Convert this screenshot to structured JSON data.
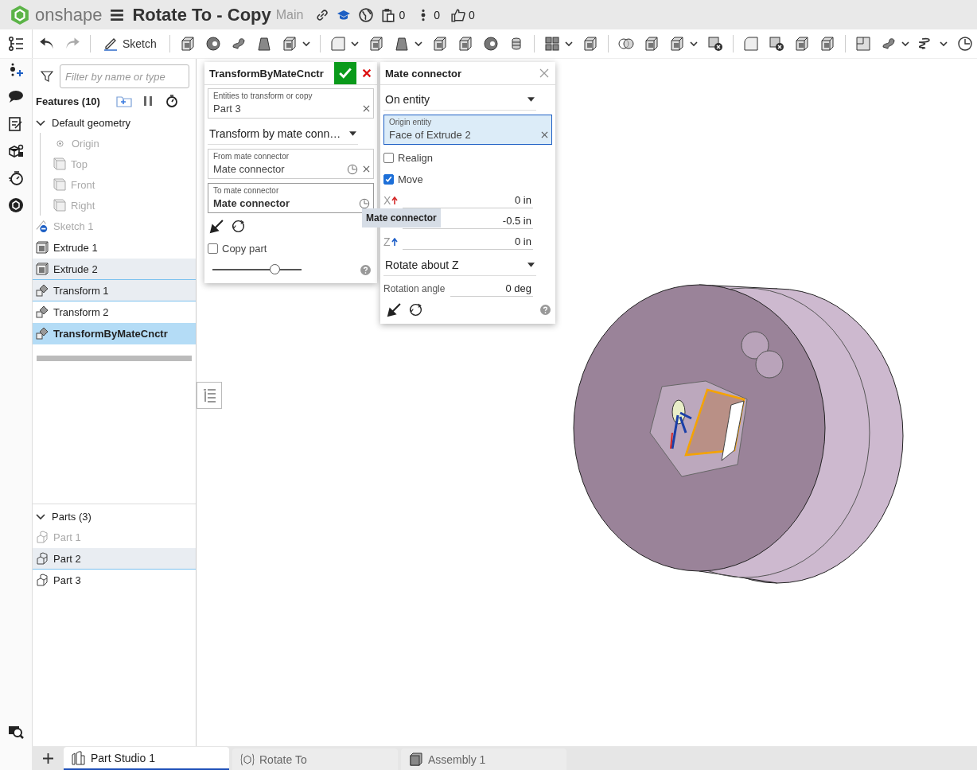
{
  "header": {
    "logo": "onshape",
    "title": "Rotate To - Copy",
    "branch": "Main",
    "counts": [
      {
        "kind": "versions",
        "value": "0"
      },
      {
        "kind": "branches",
        "value": "0"
      },
      {
        "kind": "likes",
        "value": "0"
      }
    ]
  },
  "toolbar": {
    "sketch_label": "Sketch"
  },
  "feature_list": {
    "filter_placeholder": "Filter by name or type",
    "heading": "Features (10)",
    "default_geometry": {
      "label": "Default geometry",
      "expanded": true,
      "children": [
        {
          "label": "Origin",
          "kind": "origin"
        },
        {
          "label": "Top",
          "kind": "plane"
        },
        {
          "label": "Front",
          "kind": "plane"
        },
        {
          "label": "Right",
          "kind": "plane"
        }
      ]
    },
    "features": [
      {
        "label": "Sketch 1",
        "kind": "sketch",
        "suppressed": true,
        "highlighted": false,
        "selected": false
      },
      {
        "label": "Extrude 1",
        "kind": "extrude",
        "suppressed": false,
        "highlighted": false,
        "selected": false
      },
      {
        "label": "Extrude 2",
        "kind": "extrude",
        "suppressed": false,
        "highlighted": true,
        "selected": false
      },
      {
        "label": "Transform 1",
        "kind": "transform",
        "suppressed": false,
        "highlighted": true,
        "selected": false
      },
      {
        "label": "Transform 2",
        "kind": "transform",
        "suppressed": false,
        "highlighted": false,
        "selected": false
      },
      {
        "label": "TransformByMateCnctr",
        "kind": "transform",
        "suppressed": false,
        "highlighted": false,
        "selected": true
      }
    ]
  },
  "parts": {
    "label": "Parts (3)",
    "expanded": true,
    "children": [
      {
        "label": "Part 1",
        "hidden": true,
        "highlighted": false
      },
      {
        "label": "Part 2",
        "hidden": false,
        "highlighted": true
      },
      {
        "label": "Part 3",
        "hidden": false,
        "highlighted": false
      }
    ]
  },
  "transform_dialog": {
    "title": "TransformByMateCnctr",
    "fields": [
      {
        "label": "Entities to transform or copy",
        "value": "Part 3",
        "kind": "entity",
        "active": false
      },
      {
        "kind": "dropdown",
        "value": "Transform by mate conn…"
      },
      {
        "label": "From mate connector",
        "value": "Mate connector",
        "kind": "connector",
        "active": false
      },
      {
        "label": "To mate connector",
        "value": "Mate connector",
        "kind": "connector",
        "active": true
      }
    ],
    "copy_part": {
      "label": "Copy part",
      "checked": false
    },
    "slider": {
      "level": 0.7
    }
  },
  "tooltip": "Mate connector",
  "mate_dialog": {
    "title": "Mate connector",
    "mode": "On entity",
    "origin": {
      "label": "Origin entity",
      "value": "Face of Extrude 2",
      "selected": true
    },
    "options": [
      {
        "label": "Realign",
        "checked": false
      },
      {
        "label": "Move",
        "checked": true
      }
    ],
    "offsets": [
      {
        "label": "X",
        "value": "0 in",
        "color": "#d42a2a"
      },
      {
        "value": "-0.5 in"
      },
      {
        "label": "Z",
        "value": "0 in",
        "color": "#1f5fc8"
      }
    ],
    "rotation_axis": "Rotate about Z",
    "rotation": {
      "label": "Rotation angle",
      "value": "0 deg"
    }
  },
  "tabs": [
    {
      "label": "Part Studio 1",
      "kind": "partstudio",
      "selected": true
    },
    {
      "label": "Rotate To",
      "kind": "feature",
      "selected": false
    },
    {
      "label": "Assembly 1",
      "kind": "assembly",
      "selected": false
    }
  ]
}
